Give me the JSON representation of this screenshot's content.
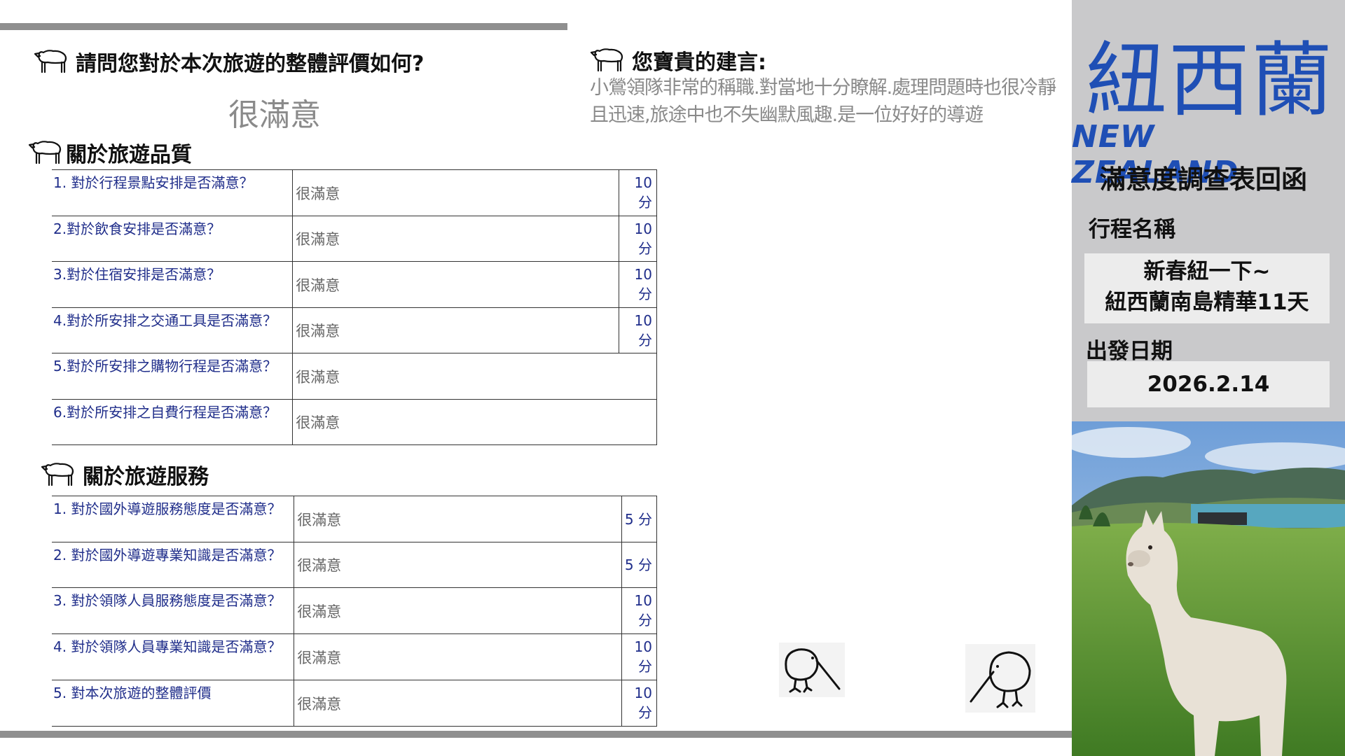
{
  "overall": {
    "question": "請問您對於本次旅遊的整體評價如何?",
    "answer": "很滿意"
  },
  "suggestion": {
    "heading": "您寶貴的建言:",
    "text": "小鶯領隊非常的稱職.對當地十分瞭解.處理問題時也很冷靜且迅速,旅途中也不失幽默風趣.是一位好好的導遊"
  },
  "quality": {
    "heading": "關於旅遊品質",
    "rows": [
      {
        "question": "1. 對於行程景點安排是否滿意？",
        "answer": "很滿意",
        "score": "10 分"
      },
      {
        "question": "2.對於飲食安排是否滿意？",
        "answer": "很滿意",
        "score": "10 分"
      },
      {
        "question": "3.對於住宿安排是否滿意？",
        "answer": "很滿意",
        "score": "10 分"
      },
      {
        "question": "4.對於所安排之交通工具是否滿意？",
        "answer": "很滿意",
        "score": "10 分"
      },
      {
        "question": "5.對於所安排之購物行程是否滿意？",
        "answer": "很滿意",
        "score": ""
      },
      {
        "question": "6.對於所安排之自費行程是否滿意？",
        "answer": "很滿意",
        "score": ""
      }
    ]
  },
  "service": {
    "heading": "關於旅遊服務",
    "rows": [
      {
        "question": "1. 對於國外導遊服務態度是否滿意？",
        "answer": "很滿意",
        "score": "5 分"
      },
      {
        "question": "2. 對於國外導遊專業知識是否滿意？",
        "answer": "很滿意",
        "score": "5 分"
      },
      {
        "question": "3. 對於領隊人員服務態度是否滿意？",
        "answer": "很滿意",
        "score": "10 分"
      },
      {
        "question": "4. 對於領隊人員專業知識是否滿意？",
        "answer": "很滿意",
        "score": "10 分"
      },
      {
        "question": "5. 對本次旅遊的整體評價",
        "answer": "很滿意",
        "score": "10 分"
      }
    ]
  },
  "sidebar": {
    "title_zh": "紐西蘭",
    "title_en": "NEW ZEALAND",
    "survey_title": "滿意度調查表回函",
    "trip_label": "行程名稱",
    "trip_name_line1": "新春紐一下~",
    "trip_name_line2": "紐西蘭南島精華11天",
    "date_label": "出發日期",
    "date_value": "2026.2.14"
  },
  "colors": {
    "accent_blue": "#1f4fb5",
    "question_text": "#1f2d8a",
    "sidebar_bg": "#c9c9cb",
    "rule_gray": "#8f8f8f"
  },
  "icons": [
    "sheep-icon",
    "kiwi-icon"
  ]
}
